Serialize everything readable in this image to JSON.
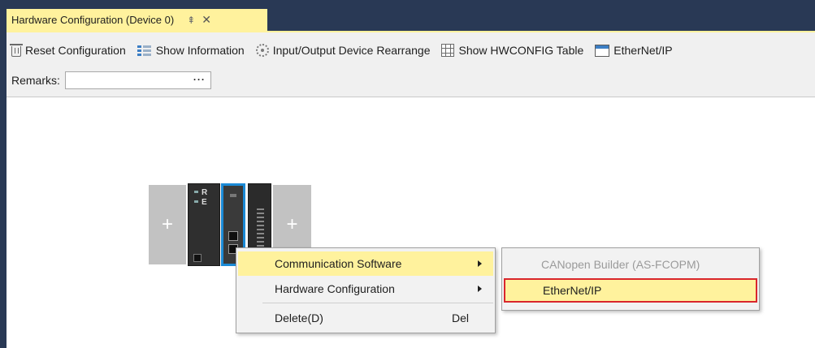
{
  "document_tab": {
    "title": "Hardware Configuration (Device 0)",
    "pin_glyph": "⇞",
    "close_glyph": "✕"
  },
  "toolbar": {
    "items": [
      {
        "label": "Reset Configuration",
        "icon": "trash-icon"
      },
      {
        "label": "Show Information",
        "icon": "info-list-icon"
      },
      {
        "label": "Input/Output Device Rearrange",
        "icon": "gear-icon"
      },
      {
        "label": "Show HWCONFIG Table",
        "icon": "table-icon"
      },
      {
        "label": "EtherNet/IP",
        "icon": "window-icon"
      }
    ]
  },
  "remarks": {
    "label": "Remarks:",
    "value": "",
    "ellipsis": "···"
  },
  "canvas": {
    "add_slot_glyph": "+",
    "cpu_labels": [
      "R",
      "E"
    ]
  },
  "context_menu": {
    "items": [
      {
        "label": "Communication Software",
        "has_submenu": true,
        "highlighted": true
      },
      {
        "label": "Hardware Configuration",
        "has_submenu": true,
        "highlighted": false
      },
      {
        "label": "Delete(D)",
        "shortcut": "Del",
        "has_submenu": false
      }
    ]
  },
  "submenu": {
    "items": [
      {
        "label": "CANopen Builder (AS-FCOPM)",
        "enabled": false
      },
      {
        "label": "EtherNet/IP",
        "enabled": true,
        "highlighted": true
      }
    ]
  },
  "colors": {
    "tab_strip": "#293955",
    "active_tab": "#fff29d",
    "menu_highlight": "#fff29d",
    "selection_border": "#1b8ad6",
    "callout_border": "#d9262c"
  }
}
